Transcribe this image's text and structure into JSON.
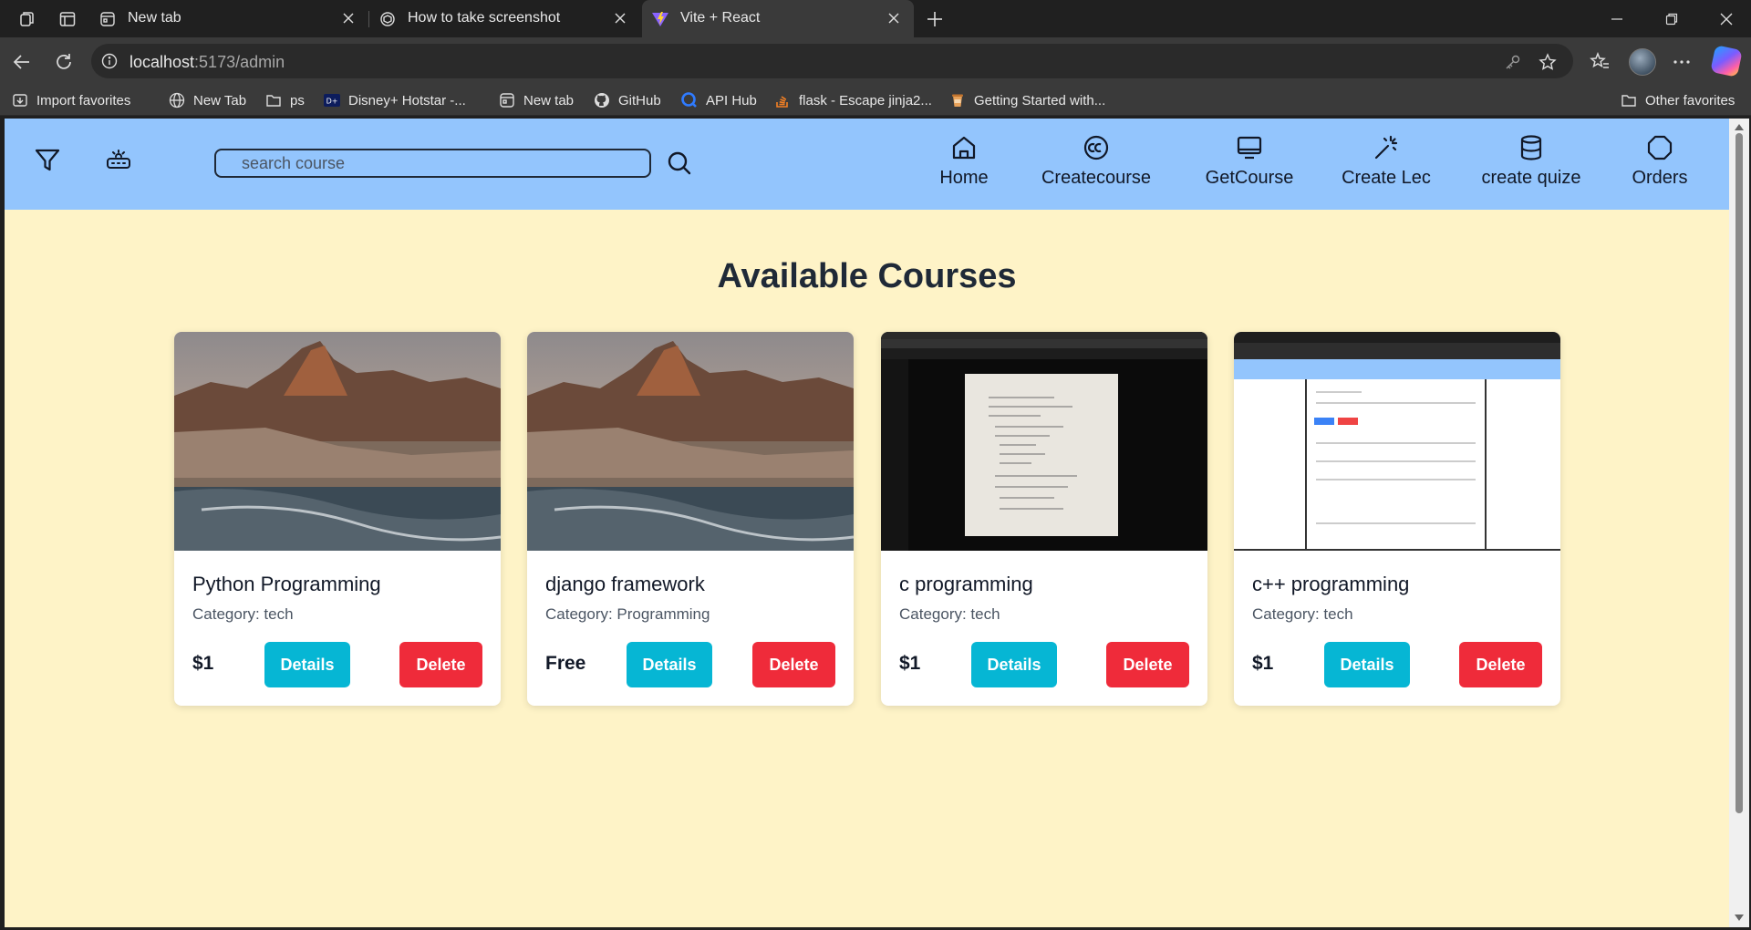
{
  "browser": {
    "tabs": [
      {
        "title": "New tab",
        "icon": "newtab-page-icon",
        "active": false
      },
      {
        "title": "How to take screenshot",
        "icon": "chatgpt-icon",
        "active": false
      },
      {
        "title": "Vite + React",
        "icon": "vite-icon",
        "active": true
      }
    ],
    "url_host": "localhost",
    "url_rest": ":5173/admin",
    "bookmarks": [
      {
        "label": "Import favorites",
        "icon": "import-icon"
      },
      {
        "label": "New Tab",
        "icon": "globe-icon"
      },
      {
        "label": "ps",
        "icon": "folder-icon"
      },
      {
        "label": "Disney+ Hotstar -...",
        "icon": "hotstar-icon"
      },
      {
        "label": "New tab",
        "icon": "newtab-page-icon"
      },
      {
        "label": "GitHub",
        "icon": "github-icon"
      },
      {
        "label": "API Hub",
        "icon": "api-hub-icon"
      },
      {
        "label": "flask - Escape jinja2...",
        "icon": "stackoverflow-icon"
      },
      {
        "label": "Getting Started with...",
        "icon": "cup-icon"
      }
    ],
    "other_favorites": "Other favorites"
  },
  "app": {
    "search_placeholder": "search course",
    "nav": [
      {
        "label": "Home",
        "icon": "home-icon"
      },
      {
        "label": "Createcourse",
        "icon": "cc-icon"
      },
      {
        "label": "GetCourse",
        "icon": "monitor-icon"
      },
      {
        "label": "Create Lec",
        "icon": "wand-icon"
      },
      {
        "label": "create quize",
        "icon": "database-icon"
      },
      {
        "label": "Orders",
        "icon": "octagon-icon"
      }
    ],
    "page_title": "Available Courses",
    "details_label": "Details",
    "delete_label": "Delete",
    "courses": [
      {
        "title": "Python Programming",
        "category": "Category: tech",
        "price": "$1",
        "thumbnail": "mountain-city-photo"
      },
      {
        "title": "django framework",
        "category": "Category: Programming",
        "price": "Free",
        "thumbnail": "mountain-city-photo"
      },
      {
        "title": "c programming",
        "category": "Category: tech",
        "price": "$1",
        "thumbnail": "screenshot-of-paper"
      },
      {
        "title": "c++ programming",
        "category": "Category: tech",
        "price": "$1",
        "thumbnail": "screenshot-of-app"
      }
    ]
  },
  "colors": {
    "nav_bg": "#93c5fd",
    "page_bg": "#fef3c7",
    "details_btn": "#06b6d4",
    "delete_btn": "#ef2b3a"
  }
}
